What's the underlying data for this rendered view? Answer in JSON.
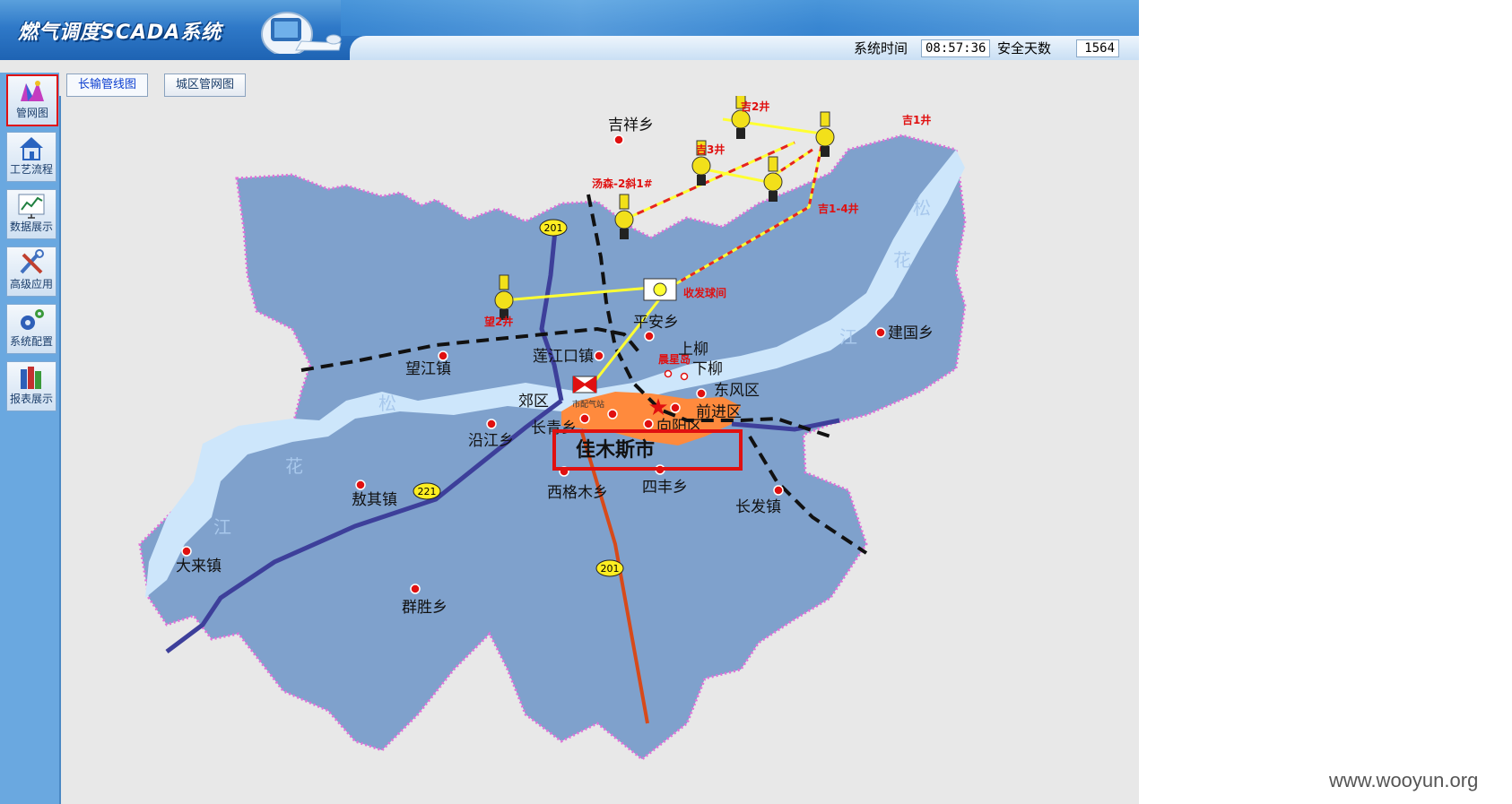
{
  "header": {
    "app_title": "燃气调度SCADA系统",
    "system_time_label": "系统时间",
    "system_time_value": "08:57:36",
    "safe_days_label": "安全天数",
    "safe_days_value": "1564"
  },
  "sidebar": {
    "items": [
      {
        "label": "管网图",
        "icon": "pipeline-map-icon",
        "active": true
      },
      {
        "label": "工艺流程",
        "icon": "house-icon",
        "active": false
      },
      {
        "label": "数据展示",
        "icon": "chart-icon",
        "active": false
      },
      {
        "label": "高级应用",
        "icon": "tools-icon",
        "active": false
      },
      {
        "label": "系统配置",
        "icon": "gears-icon",
        "active": false
      },
      {
        "label": "报表展示",
        "icon": "books-icon",
        "active": false
      }
    ]
  },
  "tabs": [
    {
      "label": "长输管线图",
      "active": true
    },
    {
      "label": "城区管网图",
      "active": false
    }
  ],
  "map": {
    "wells": {
      "ji2": "吉2井",
      "ji1": "吉1井",
      "ji3": "吉3井",
      "ji14": "吉1-4井",
      "tangsen": "汤森-2斜1#",
      "wang2": "望2井"
    },
    "facilities": {
      "receiving_station": "收发球间",
      "distribution_station": "市配气站"
    },
    "roads": {
      "r201_top": "201",
      "r221": "221",
      "r201_bottom": "201"
    },
    "rivers": [
      "松",
      "花",
      "江",
      "松",
      "花",
      "江"
    ],
    "places": {
      "jixiang": "吉祥乡",
      "pingan": "平安乡",
      "shangliu": "上柳",
      "xialiu": "下柳",
      "chenxing": "晨星岛",
      "jianguo": "建国乡",
      "wangjiang": "望江镇",
      "lianjiangkou": "莲江口镇",
      "jiaoqu": "郊区",
      "dongfeng": "东风区",
      "qianjin": "前进区",
      "changqing": "长青乡",
      "xiangyang": "向阳区",
      "yanjiang": "沿江乡",
      "sanqi": "敖其镇",
      "xigemu": "西格木乡",
      "sifeng": "四丰乡",
      "changfa": "长发镇",
      "dalai": "大来镇",
      "qunsheng": "群胜乡"
    },
    "city_label": "佳木斯市"
  },
  "watermark": "www.wooyun.org",
  "colors": {
    "land": "#7fa1cc",
    "river": "#cde6fb",
    "border": "#e070d8",
    "pipeline": "#ffff33",
    "pipe_red": "#e52222",
    "highlight": "#e01010",
    "urban": "#ff8a3d"
  }
}
